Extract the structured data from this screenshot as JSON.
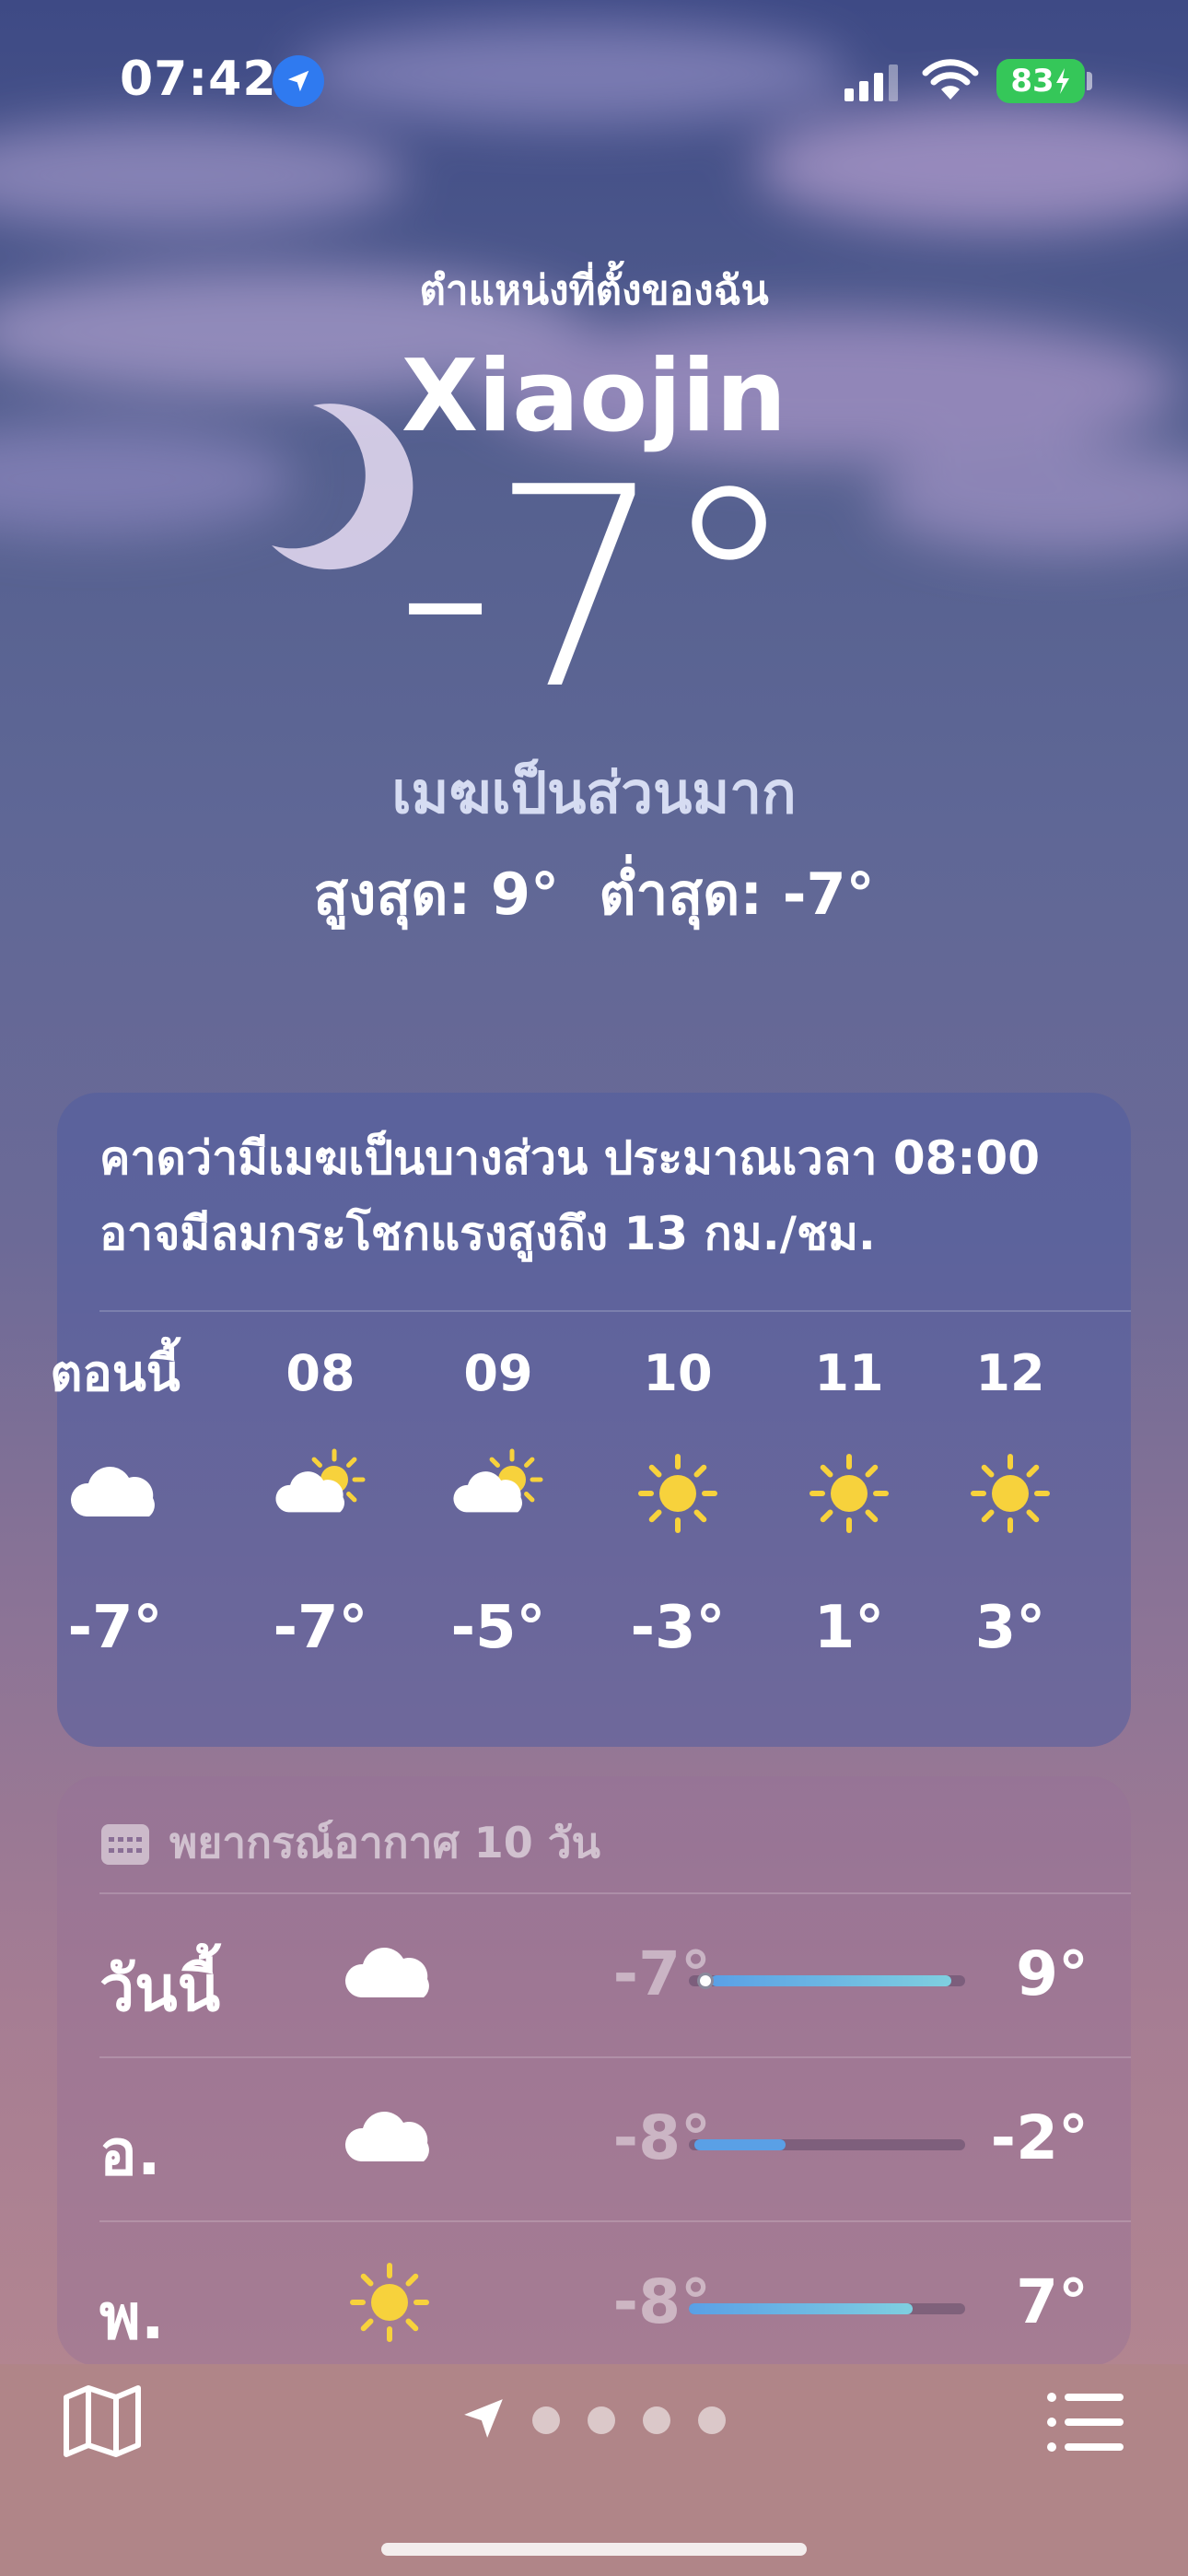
{
  "status_bar": {
    "time": "07:42",
    "battery": "83"
  },
  "header": {
    "my_location": "ตำแหน่งที่ตั้งของฉัน",
    "city": "Xiaojin",
    "temperature": "-7°",
    "condition": "เมฆเป็นส่วนมาก",
    "high_low": "สูงสุด: 9°  ต่ำสุด: -7°"
  },
  "hourly": {
    "summary_line1": "คาดว่ามีเมฆเป็นบางส่วน ประมาณเวลา 08:00",
    "summary_line2": "อาจมีลมกระโชกแรงสูงถึง 13 กม./ชม.",
    "hours": [
      {
        "label": "ตอนนี้",
        "icon": "cloud-icon",
        "temp": "-7°"
      },
      {
        "label": "08",
        "icon": "partly-sunny-icon",
        "temp": "-7°"
      },
      {
        "label": "09",
        "icon": "partly-sunny-icon",
        "temp": "-5°"
      },
      {
        "label": "10",
        "icon": "sun-icon",
        "temp": "-3°"
      },
      {
        "label": "11",
        "icon": "sun-icon",
        "temp": "1°"
      },
      {
        "label": "12",
        "icon": "sun-icon",
        "temp": "3°"
      }
    ]
  },
  "forecast": {
    "title": "พยากรณ์อากาศ 10 วัน",
    "days": [
      {
        "day": "วันนี้",
        "icon": "cloud-icon",
        "low": "-7°",
        "high": "9°",
        "range_start": 0.08,
        "range_end": 0.95,
        "current": 0.06
      },
      {
        "day": "อ.",
        "icon": "cloud-icon",
        "low": "-8°",
        "high": "-2°",
        "range_start": 0.02,
        "range_end": 0.35
      },
      {
        "day": "พ.",
        "icon": "sun-icon",
        "low": "-8°",
        "high": "7°",
        "range_start": 0.0,
        "range_end": 0.81
      }
    ]
  },
  "bottom_bar": {
    "page_count": 4
  },
  "colors": {
    "location_badge": "#2f7af0",
    "battery": "#35c759",
    "sun": "#f7d23c",
    "bar_cool": "#5aa0e6",
    "bar_mild": "#7fcfe0"
  }
}
